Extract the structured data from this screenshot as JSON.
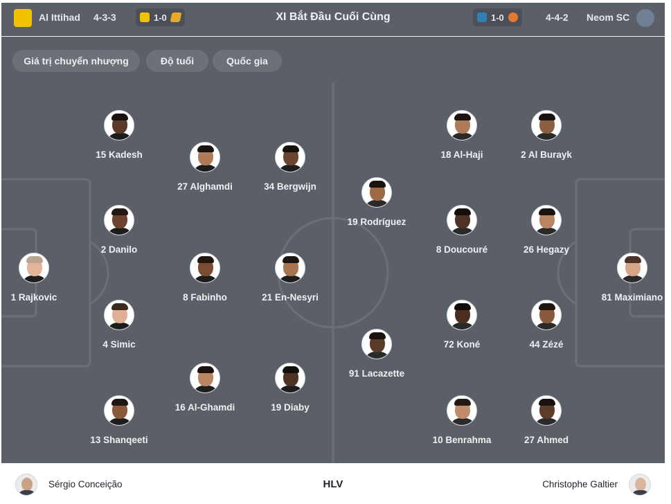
{
  "header": {
    "title": "XI Bắt Đầu Cuối Cùng",
    "home": {
      "name": "Al Ittihad",
      "formation": "4-3-3",
      "score": "1-0",
      "color": "#f2c200"
    },
    "away": {
      "name": "Neom SC",
      "formation": "4-4-2",
      "score": "1-0",
      "color": "#e6772e"
    }
  },
  "filters": [
    "Giá trị chuyển nhượng",
    "Độ tuổi",
    "Quốc gia"
  ],
  "home_players": [
    {
      "label": "1 Rajkovic",
      "skin": "#e2b59a",
      "hair": "#b9a58e",
      "shirt": "#1d1d1d"
    },
    {
      "label": "15 Kadesh",
      "skin": "#5a3a28",
      "hair": "#1a120e",
      "shirt": "#1d1d1d"
    },
    {
      "label": "2 Danilo",
      "skin": "#6b4330",
      "hair": "#231812",
      "shirt": "#1d1d1d"
    },
    {
      "label": "4 Simic",
      "skin": "#e0b096",
      "hair": "#3a2a20",
      "shirt": "#1d1d1d"
    },
    {
      "label": "13 Shanqeeti",
      "skin": "#8a5a3c",
      "hair": "#1f1612",
      "shirt": "#1d1d1d"
    },
    {
      "label": "27 Alghamdi",
      "skin": "#b07b58",
      "hair": "#1c1410",
      "shirt": "#1d1d1d"
    },
    {
      "label": "8 Fabinho",
      "skin": "#7a4c34",
      "hair": "#221711",
      "shirt": "#1d1d1d"
    },
    {
      "label": "16 Al-Ghamdi",
      "skin": "#b98462",
      "hair": "#1a120e",
      "shirt": "#1d1d1d"
    },
    {
      "label": "34 Bergwijn",
      "skin": "#6e4430",
      "hair": "#15100c",
      "shirt": "#1d1d1d"
    },
    {
      "label": "21 En-Nesyri",
      "skin": "#a8734f",
      "hair": "#1c1410",
      "shirt": "#1d1d1d"
    },
    {
      "label": "19 Diaby",
      "skin": "#4e3223",
      "hair": "#140f0b",
      "shirt": "#1d1d1d"
    }
  ],
  "away_players": [
    {
      "label": "18 Al-Haji",
      "skin": "#b07b58",
      "hair": "#1c1410",
      "shirt": "#2a2a2a"
    },
    {
      "label": "2 Al Burayk",
      "skin": "#8d5f42",
      "hair": "#1a120e",
      "shirt": "#2a2a2a"
    },
    {
      "label": "19 Rodríguez",
      "skin": "#9d6a48",
      "hair": "#1a120e",
      "shirt": "#2a2a2a"
    },
    {
      "label": "8 Doucouré",
      "skin": "#4e3223",
      "hair": "#140f0b",
      "shirt": "#2a2a2a"
    },
    {
      "label": "26 Hegazy",
      "skin": "#b98462",
      "hair": "#1c1410",
      "shirt": "#2a2a2a"
    },
    {
      "label": "81 Maximiano",
      "skin": "#d6a689",
      "hair": "#4a3528",
      "shirt": "#2a2a2a"
    },
    {
      "label": "72 Koné",
      "skin": "#4a2f21",
      "hair": "#120d0a",
      "shirt": "#2a2a2a"
    },
    {
      "label": "44 Zézé",
      "skin": "#8a5a3c",
      "hair": "#1f1612",
      "shirt": "#2a2a2a"
    },
    {
      "label": "91 Lacazette",
      "skin": "#5a3a28",
      "hair": "#1a120e",
      "shirt": "#2a2a2a"
    },
    {
      "label": "10 Benrahma",
      "skin": "#c08c6a",
      "hair": "#241a14",
      "shirt": "#2a2a2a"
    },
    {
      "label": "27 Ahmed",
      "skin": "#5e3c2a",
      "hair": "#1a120e",
      "shirt": "#2a2a2a"
    }
  ],
  "coaches": {
    "home": "Sérgio Conceição",
    "label": "HLV",
    "away": "Christophe Galtier"
  }
}
